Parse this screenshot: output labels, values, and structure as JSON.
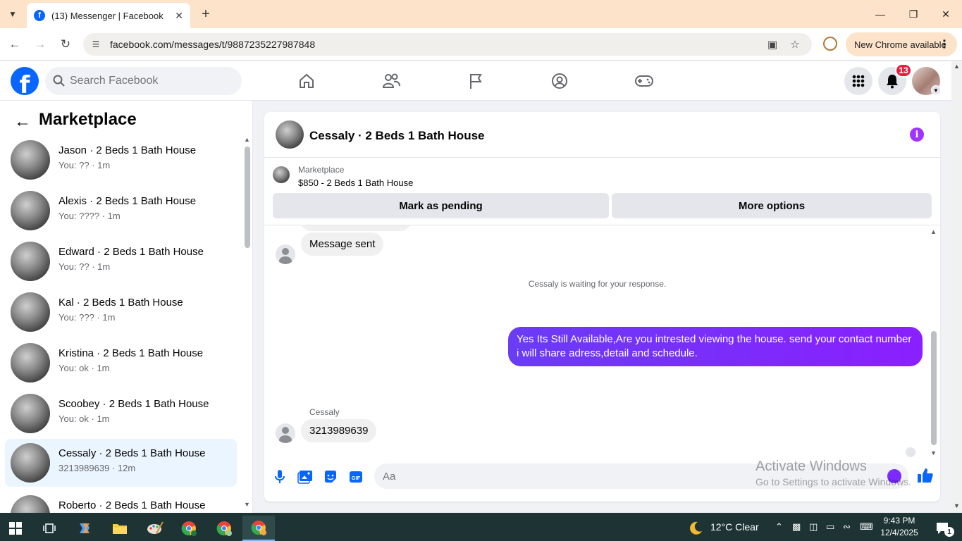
{
  "browser": {
    "tab_title": "(13) Messenger | Facebook",
    "url": "facebook.com/messages/t/9887235227987848",
    "new_chrome_label": "New Chrome available"
  },
  "fb": {
    "search_placeholder": "Search Facebook",
    "notification_count": "13",
    "brand_color": "#0866ff"
  },
  "sidebar": {
    "title": "Marketplace",
    "conversations": [
      {
        "name": "Jason · 2 Beds 1 Bath House",
        "snippet": "You: ?? · 1m"
      },
      {
        "name": "Alexis · 2 Beds 1 Bath House",
        "snippet": "You: ???? · 1m"
      },
      {
        "name": "Edward · 2 Beds 1 Bath House",
        "snippet": "You: ?? · 1m"
      },
      {
        "name": "Kal · 2 Beds 1 Bath House",
        "snippet": "You: ??? · 1m"
      },
      {
        "name": "Kristina · 2 Beds 1 Bath House",
        "snippet": "You: ok · 1m"
      },
      {
        "name": "Scoobey · 2 Beds 1 Bath House",
        "snippet": "You: ok · 1m"
      },
      {
        "name": "Cessaly · 2 Beds 1 Bath House",
        "snippet": "3213989639 · 12m"
      },
      {
        "name": "Roberto · 2 Beds 1 Bath House",
        "snippet": ""
      }
    ]
  },
  "chat": {
    "title": "Cessaly · 2 Beds 1 Bath House",
    "marketplace_label": "Marketplace",
    "listing": "$850 - 2 Beds 1 Bath House",
    "mark_pending": "Mark as pending",
    "more_options": "More options",
    "msg_sent": "Message sent",
    "waiting": "Cessaly is waiting for your response.",
    "outgoing": "Yes Its Still Available,Are you intrested viewing the house. send your contact number i will share adress,detail and schedule.",
    "sender": "Cessaly",
    "incoming": "3213989639",
    "composer_placeholder": "Aa",
    "accent": "#7c2bff"
  },
  "watermark": {
    "line1": "Activate Windows",
    "line2": "Go to Settings to activate Windows."
  },
  "taskbar": {
    "weather": "12°C  Clear",
    "time": "9:43 PM",
    "date": "12/4/2025",
    "notif_count": "1"
  }
}
